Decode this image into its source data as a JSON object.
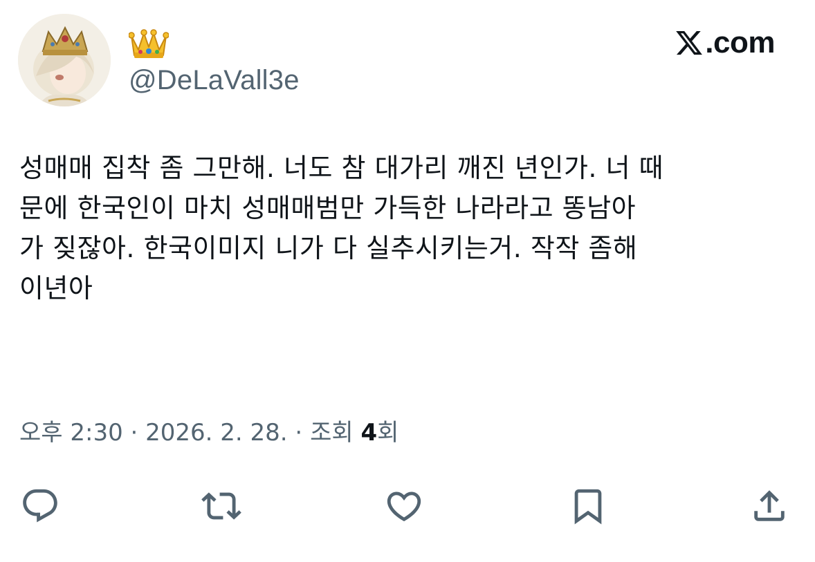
{
  "author": {
    "display_name_emoji": "👑",
    "handle": "@DeLaVall3e"
  },
  "brand": {
    "logo_icon": "x-logo-icon",
    "domain": ".com"
  },
  "tweet": {
    "text": "성매매 집착 좀 그만해. 너도 참 대가리 깨진 년인가. 너 때\n문에 한국인이 마치 성매매범만 가득한 나라라고 똥남아\n가 짖잖아. 한국이미지 니가 다 실추시키는거. 작작 좀해\n이년아"
  },
  "meta": {
    "time": "오후 2:30",
    "separator1": " · ",
    "date": "2026. 2. 28.",
    "separator2": " · ",
    "views_label": "조회 ",
    "views_count": "4",
    "views_suffix": "회"
  },
  "actions": [
    {
      "name": "reply",
      "icon": "reply-icon"
    },
    {
      "name": "retweet",
      "icon": "retweet-icon"
    },
    {
      "name": "like",
      "icon": "heart-icon"
    },
    {
      "name": "bookmark",
      "icon": "bookmark-icon"
    },
    {
      "name": "share",
      "icon": "share-icon"
    }
  ],
  "colors": {
    "text_primary": "#0f1419",
    "text_secondary": "#536471",
    "background": "#ffffff"
  }
}
